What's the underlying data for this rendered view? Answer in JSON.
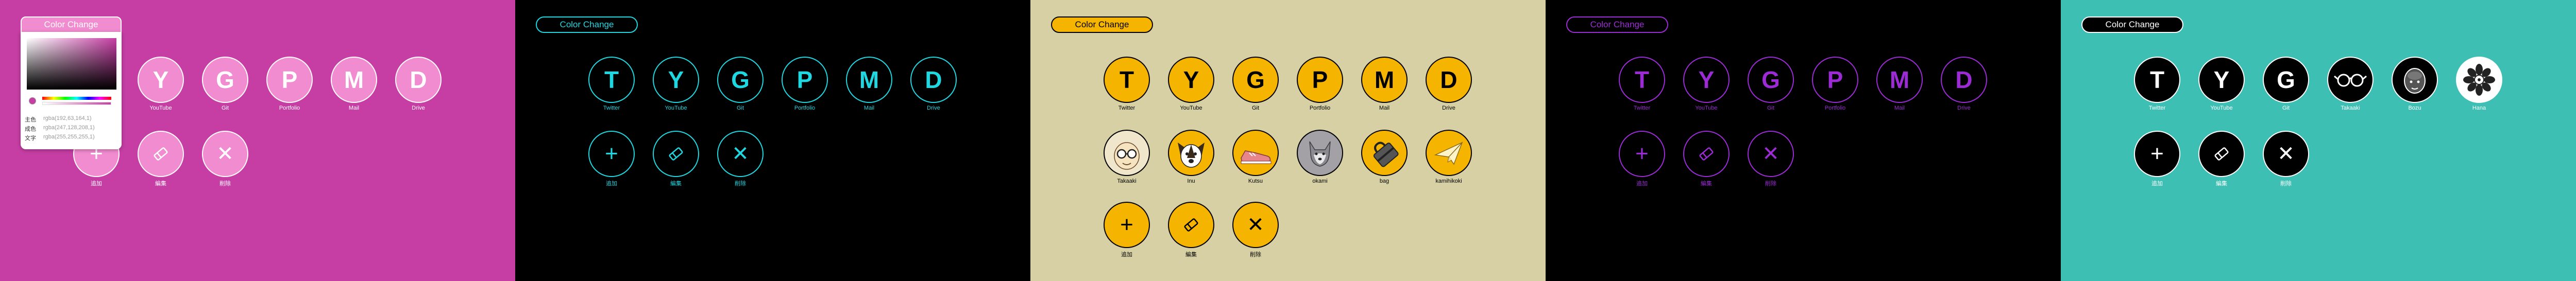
{
  "color_change_label": "Color Change",
  "icon_labels": {
    "add": "追加",
    "edit": "編集",
    "delete": "削除"
  },
  "panels": [
    {
      "theme": "magenta",
      "bg": "#c63ea4",
      "row1": [
        {
          "letter": "Y",
          "label": "YouTube"
        },
        {
          "letter": "G",
          "label": "Git"
        },
        {
          "letter": "P",
          "label": "Portfolio"
        },
        {
          "letter": "M",
          "label": "Mail"
        },
        {
          "letter": "D",
          "label": "Drive"
        }
      ],
      "picker": {
        "rows": [
          {
            "key": "主色",
            "value": "rgba(192,63,164,1)"
          },
          {
            "key": "成色",
            "value": "rgba(247,128,208,1)"
          },
          {
            "key": "文字",
            "value": "rgba(255,255,255,1)"
          }
        ]
      }
    },
    {
      "theme": "black-cyan",
      "bg": "#000000",
      "accent": "#1fd7e1",
      "row1": [
        {
          "letter": "T",
          "label": "Twitter"
        },
        {
          "letter": "Y",
          "label": "YouTube"
        },
        {
          "letter": "G",
          "label": "Git"
        },
        {
          "letter": "P",
          "label": "Portfolio"
        },
        {
          "letter": "M",
          "label": "Mail"
        },
        {
          "letter": "D",
          "label": "Drive"
        }
      ]
    },
    {
      "theme": "beige-yellow",
      "bg": "#d6d0a4",
      "accent": "#f5b400",
      "row1": [
        {
          "letter": "T",
          "label": "Twitter"
        },
        {
          "letter": "Y",
          "label": "YouTube"
        },
        {
          "letter": "G",
          "label": "Git"
        },
        {
          "letter": "P",
          "label": "Portfolio"
        },
        {
          "letter": "M",
          "label": "Mail"
        },
        {
          "letter": "D",
          "label": "Drive"
        }
      ],
      "row2": [
        {
          "icon": "glasses-face-icon",
          "label": "Takaaki"
        },
        {
          "icon": "dog-icon",
          "label": "Inu"
        },
        {
          "icon": "shoe-icon",
          "label": "Kutsu"
        },
        {
          "icon": "wolf-icon",
          "label": "okami"
        },
        {
          "icon": "bag-icon",
          "label": "bag"
        },
        {
          "icon": "paper-plane-icon",
          "label": "kamihikoki"
        }
      ]
    },
    {
      "theme": "black-purple",
      "bg": "#000000",
      "accent": "#9c2bd6",
      "row1": [
        {
          "letter": "T",
          "label": "Twitter"
        },
        {
          "letter": "Y",
          "label": "YouTube"
        },
        {
          "letter": "G",
          "label": "Git"
        },
        {
          "letter": "P",
          "label": "Portfolio"
        },
        {
          "letter": "M",
          "label": "Mail"
        },
        {
          "letter": "D",
          "label": "Drive"
        }
      ]
    },
    {
      "theme": "teal-black",
      "bg": "#3ebfb3",
      "row1": [
        {
          "letter": "T",
          "label": "Twitter"
        },
        {
          "letter": "Y",
          "label": "YouTube"
        },
        {
          "letter": "G",
          "label": "Git"
        },
        {
          "icon": "glasses-icon",
          "label": "Takaaki"
        },
        {
          "icon": "bald-head-icon",
          "label": "Bozu"
        },
        {
          "icon": "flower-icon",
          "label": "Hana"
        }
      ]
    }
  ]
}
